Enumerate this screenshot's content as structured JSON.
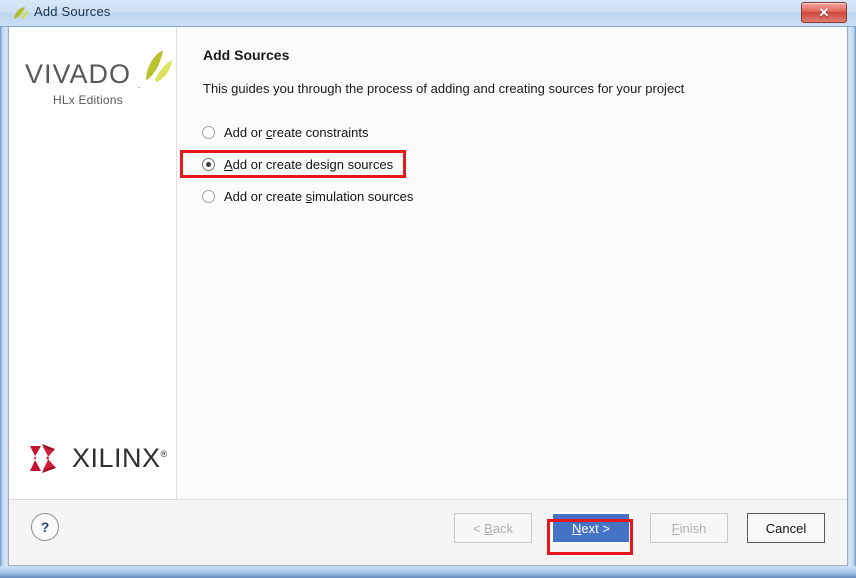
{
  "window": {
    "title": "Add Sources",
    "icon": "vivado-logo-icon",
    "close_label": "✕"
  },
  "branding": {
    "vivado_word": "VIVADO",
    "vivado_registered": ".",
    "vivado_subtitle": "HLx Editions",
    "xilinx_word": "XILINX",
    "xilinx_registered": "®"
  },
  "main": {
    "heading": "Add Sources",
    "subtext": "This guides you through the process of adding and creating sources for your project",
    "options": [
      {
        "id": "constraints",
        "pre": "Add or ",
        "mnemonic": "c",
        "post": "reate constraints",
        "selected": false
      },
      {
        "id": "design-sources",
        "pre": "",
        "mnemonic": "A",
        "post": "dd or create design sources",
        "selected": true
      },
      {
        "id": "simulation-sources",
        "pre": "Add or create ",
        "mnemonic": "s",
        "post": "imulation sources",
        "selected": false
      }
    ]
  },
  "footer": {
    "help_label": "?",
    "buttons": [
      {
        "id": "back",
        "pre": "< ",
        "mnemonic": "B",
        "post": "ack",
        "state": "disabled"
      },
      {
        "id": "next",
        "pre": "",
        "mnemonic": "N",
        "post": "ext >",
        "state": "primary"
      },
      {
        "id": "finish",
        "pre": "",
        "mnemonic": "F",
        "post": "inish",
        "state": "disabled"
      },
      {
        "id": "cancel",
        "pre": "Cancel",
        "mnemonic": "",
        "post": "",
        "state": "enabled"
      }
    ]
  },
  "annotations": {
    "color": "#e8171a",
    "targets": [
      "option-design-sources",
      "button-next"
    ]
  },
  "colors": {
    "accent_blue": "#4472c4",
    "annotation_red": "#e8171a",
    "titlebar_blue": "#cde0f4",
    "close_red": "#cf463a",
    "vivado_green": "#c8d33c",
    "xilinx_red": "#c41230"
  }
}
